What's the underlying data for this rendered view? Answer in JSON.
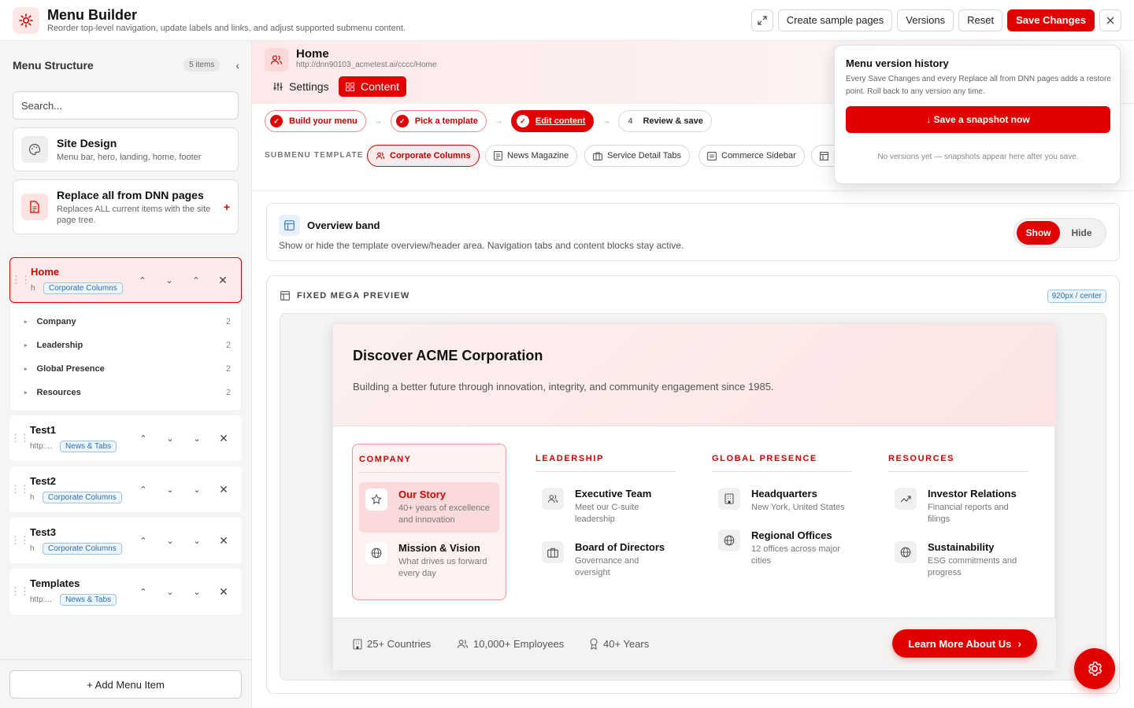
{
  "app": {
    "title": "Menu Builder",
    "subtitle": "Reorder top-level navigation, update labels and links, and adjust supported submenu content."
  },
  "toolbar": {
    "create_label": "Create sample pages",
    "versions_label": "Versions",
    "reset_label": "Reset",
    "save_label": "Save Changes"
  },
  "sidebar": {
    "title": "Menu Structure",
    "count": "5 items",
    "search_placeholder": "Search...",
    "site_design": {
      "title": "Site Design",
      "desc": "Menu bar, hero, landing, home, footer"
    },
    "replace": {
      "title": "Replace all from DNN pages",
      "desc": "Replaces ALL current items with the site page tree."
    },
    "items": [
      {
        "title": "Home",
        "url": "h",
        "tag": "Corporate Columns"
      },
      {
        "title": "Test1",
        "url": "http:...",
        "tag": "News & Tabs"
      },
      {
        "title": "Test2",
        "url": "h",
        "tag": "Corporate Columns"
      },
      {
        "title": "Test3",
        "url": "h",
        "tag": "Corporate Columns"
      },
      {
        "title": "Templates",
        "url": "http:...",
        "tag": "News & Tabs"
      }
    ],
    "subitems": [
      {
        "label": "Company",
        "count": "2"
      },
      {
        "label": "Leadership",
        "count": "2"
      },
      {
        "label": "Global Presence",
        "count": "2"
      },
      {
        "label": "Resources",
        "count": "2"
      }
    ],
    "add_label": "+ Add Menu Item"
  },
  "page": {
    "title": "Home",
    "url": "http://dnn90103_acmetest.ai/cccc/Home",
    "tabs": {
      "settings": "Settings",
      "content": "Content"
    }
  },
  "steps": [
    {
      "label": "Build your menu",
      "state": "done"
    },
    {
      "label": "Pick a template",
      "state": "done"
    },
    {
      "label": "Edit content",
      "state": "current"
    },
    {
      "label": "Review & save",
      "num": "4",
      "state": "todo"
    }
  ],
  "templates": {
    "label": "SUBMENU TEMPLATE",
    "items": [
      "Corporate Columns",
      "News Magazine",
      "Service Detail Tabs",
      "Commerce Sidebar"
    ]
  },
  "overview": {
    "title": "Overview band",
    "desc": "Show or hide the template overview/header area. Navigation tabs and content blocks stay active.",
    "show": "Show",
    "hide": "Hide"
  },
  "preview": {
    "label": "FIXED MEGA PREVIEW",
    "size": "920px / center",
    "heading": "Discover ACME Corporation",
    "text": "Building a better future through innovation, integrity, and community engagement since 1985.",
    "columns": [
      {
        "head": "COMPANY",
        "links": [
          {
            "title": "Our Story",
            "desc": "40+ years of excellence and innovation",
            "icon": "star-icon"
          },
          {
            "title": "Mission & Vision",
            "desc": "What drives us forward every day",
            "icon": "globe-icon"
          }
        ]
      },
      {
        "head": "LEADERSHIP",
        "links": [
          {
            "title": "Executive Team",
            "desc": "Meet our C-suite leadership",
            "icon": "users-icon"
          },
          {
            "title": "Board of Directors",
            "desc": "Governance and oversight",
            "icon": "briefcase-icon"
          }
        ]
      },
      {
        "head": "GLOBAL PRESENCE",
        "links": [
          {
            "title": "Headquarters",
            "desc": "New York, United States",
            "icon": "building-icon"
          },
          {
            "title": "Regional Offices",
            "desc": "12 offices across major cities",
            "icon": "globe-icon"
          }
        ]
      },
      {
        "head": "RESOURCES",
        "links": [
          {
            "title": "Investor Relations",
            "desc": "Financial reports and filings",
            "icon": "trending-icon"
          },
          {
            "title": "Sustainability",
            "desc": "ESG commitments and progress",
            "icon": "globe-icon"
          }
        ]
      }
    ],
    "stats": [
      "25+ Countries",
      "10,000+ Employees",
      "40+ Years"
    ],
    "cta": "Learn More About Us"
  },
  "versions": {
    "title": "Menu version history",
    "desc": "Every Save Changes and every Replace all from DNN pages adds a restore point. Roll back to any version any time.",
    "button": "↓ Save a snapshot now",
    "empty": "No versions yet — snapshots appear here after you save."
  },
  "colors": {
    "accent": "#e00000",
    "accent_soft": "#fdeaea",
    "tag_blue": "#2a6fb0"
  }
}
